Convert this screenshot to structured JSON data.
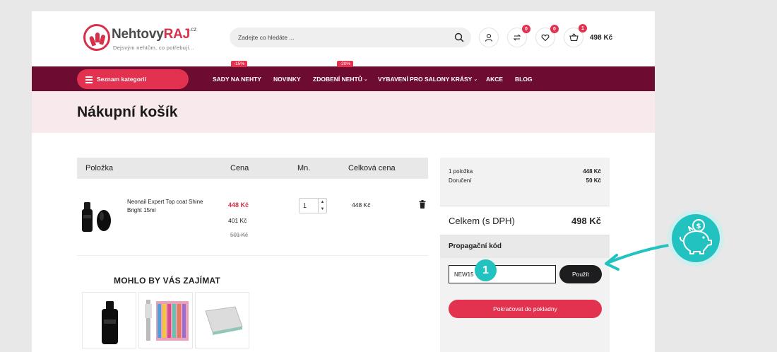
{
  "logo": {
    "name_part1": "Nehtovy",
    "name_part2": "RAJ",
    "tld": ".cz",
    "tagline": "Dejsvým nehtům, co potřebují..."
  },
  "search": {
    "placeholder": "Zadejte co hledáte ..."
  },
  "header": {
    "compare_count": "0",
    "wishlist_count": "0",
    "cart_count": "1",
    "cart_total": "498 Kč"
  },
  "nav": {
    "categories_label": "Seznam kategorií",
    "items": [
      {
        "label": "SADY NA NEHTY",
        "badge": "-15%"
      },
      {
        "label": "NOVINKY",
        "badge": ""
      },
      {
        "label": "ZDOBENÍ NEHTŮ",
        "badge": "-20%"
      },
      {
        "label": "VYBAVENÍ PRO SALONY KRÁSY",
        "badge": ""
      },
      {
        "label": "AKCE",
        "badge": ""
      },
      {
        "label": "BLOG",
        "badge": ""
      }
    ]
  },
  "page_title": "Nákupní košík",
  "cart": {
    "columns": [
      "Položka",
      "Cena",
      "Mn.",
      "Celková cena"
    ],
    "items": [
      {
        "name": "Neonail Expert Top coat Shine Bright 15ml",
        "price": "448 Kč",
        "sale_price": "401 Kč",
        "old_price": "501 Kč",
        "quantity": "1",
        "total": "448 Kč"
      }
    ]
  },
  "recommendations": {
    "title": "MOHLO BY VÁS ZAJÍMAT"
  },
  "summary": {
    "items_label": "1 položka",
    "items_value": "448 Kč",
    "shipping_label": "Doručení",
    "shipping_value": "50 Kč",
    "total_label": "Celkem (s DPH)",
    "total_value": "498 Kč",
    "promo_title": "Propagační kód",
    "promo_value": "NEW15",
    "apply_label": "Použít",
    "checkout_label": "Pokračovat do pokladny"
  },
  "annotation": {
    "step": "1"
  },
  "colors": {
    "brand": "#e2324f",
    "nav_bg": "#6e0b30",
    "accent_teal": "#22c2c0"
  }
}
